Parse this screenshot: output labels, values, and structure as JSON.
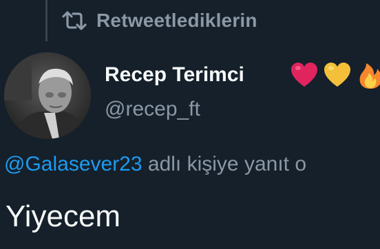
{
  "header": {
    "retweet_label": "Retweetlediklerin",
    "retweet_icon": "retweet-icon"
  },
  "tweet": {
    "author": {
      "display_name": "Recep Terimci",
      "username": "@recep_ft",
      "avatar": "avatar-photo",
      "badges": [
        "red-heart-icon",
        "yellow-heart-icon",
        "fire-icon"
      ]
    },
    "reply_context": {
      "mention": "@Galasever23",
      "suffix": " adlı kişiye yanıt o"
    },
    "text": "Yiyecem"
  },
  "colors": {
    "background": "#15202b",
    "muted_text": "#8b98a5",
    "primary_text": "#f7f9f9",
    "accent": "#1d9bf0",
    "heart_red": "#e0245e",
    "heart_yellow": "#f4c03a",
    "fire": "#f7872e"
  }
}
